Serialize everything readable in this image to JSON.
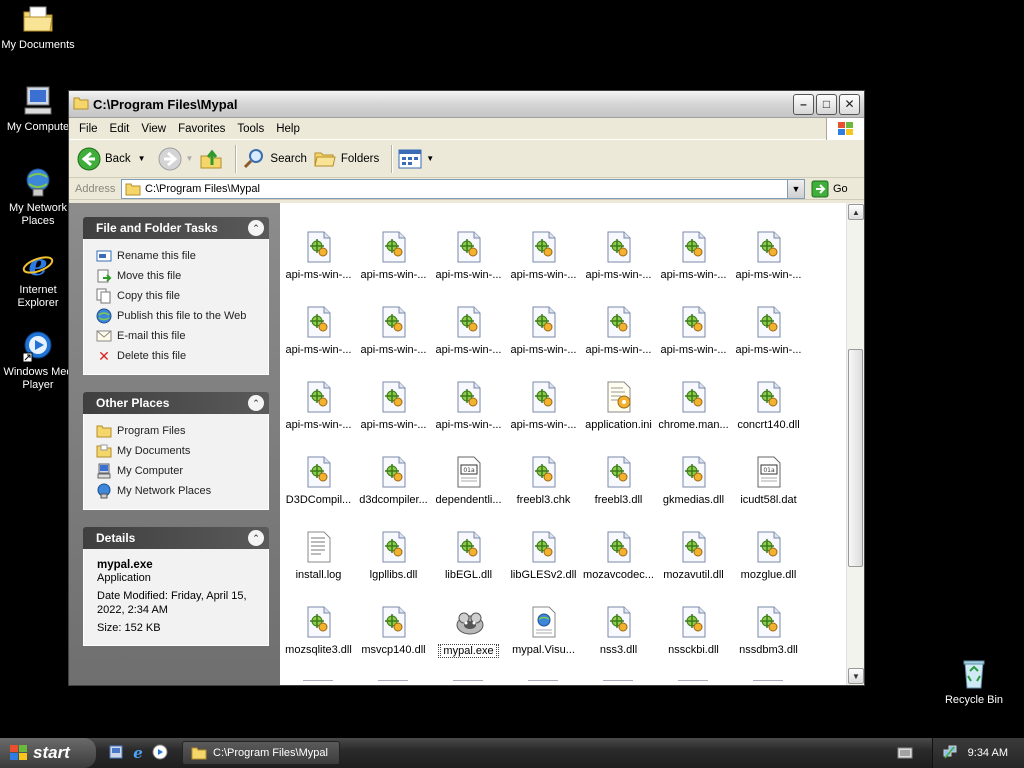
{
  "desktop": {
    "icons": [
      {
        "label": "My Documents"
      },
      {
        "label": "My Compute"
      },
      {
        "label": "My Network Places"
      },
      {
        "label": "Internet Explorer"
      },
      {
        "label": "Windows Med Player"
      },
      {
        "label": "Recycle Bin"
      }
    ]
  },
  "window": {
    "title": "C:\\Program Files\\Mypal",
    "menu": [
      "File",
      "Edit",
      "View",
      "Favorites",
      "Tools",
      "Help"
    ],
    "toolbar": {
      "back": "Back",
      "search": "Search",
      "folders": "Folders"
    },
    "address": {
      "label": "Address",
      "value": "C:\\Program Files\\Mypal",
      "go": "Go"
    }
  },
  "file_tasks": {
    "title": "File and Folder Tasks",
    "items": [
      "Rename this file",
      "Move this file",
      "Copy this file",
      "Publish this file to the Web",
      "E-mail this file",
      "Delete this file"
    ]
  },
  "other_places": {
    "title": "Other Places",
    "items": [
      "Program Files",
      "My Documents",
      "My Computer",
      "My Network Places"
    ]
  },
  "details": {
    "title": "Details",
    "name": "mypal.exe",
    "type": "Application",
    "modified_line1": "Date Modified: Friday, April 15,",
    "modified_line2": "2022, 2:34 AM",
    "size": "Size: 152 KB"
  },
  "files": [
    "api-ms-win-...",
    "api-ms-win-...",
    "api-ms-win-...",
    "api-ms-win-...",
    "api-ms-win-...",
    "api-ms-win-...",
    "api-ms-win-...",
    "api-ms-win-...",
    "api-ms-win-...",
    "api-ms-win-...",
    "api-ms-win-...",
    "api-ms-win-...",
    "api-ms-win-...",
    "api-ms-win-...",
    "api-ms-win-...",
    "api-ms-win-...",
    "api-ms-win-...",
    "api-ms-win-...",
    "application.ini",
    "chrome.man...",
    "concrt140.dll",
    "D3DCompil...",
    "d3dcompiler...",
    "dependentli...",
    "freebl3.chk",
    "freebl3.dll",
    "gkmedias.dll",
    "icudt58l.dat",
    "install.log",
    "lgpllibs.dll",
    "libEGL.dll",
    "libGLESv2.dll",
    "mozavcodec...",
    "mozavutil.dll",
    "mozglue.dll",
    "mozsqlite3.dll",
    "msvcp140.dll",
    "mypal.exe",
    "mypal.Visu...",
    "nss3.dll",
    "nssckbi.dll",
    "nssdbm3.dll"
  ],
  "file_kinds": [
    "dll",
    "dll",
    "dll",
    "dll",
    "dll",
    "dll",
    "dll",
    "dll",
    "dll",
    "dll",
    "dll",
    "dll",
    "dll",
    "dll",
    "dll",
    "dll",
    "dll",
    "dll",
    "ini",
    "dll",
    "dll",
    "dll",
    "dll",
    "dat",
    "dll",
    "dll",
    "dll",
    "dat",
    "txt",
    "dll",
    "dll",
    "dll",
    "dll",
    "dll",
    "dll",
    "dll",
    "dll",
    "exe",
    "manifest",
    "dll",
    "dll",
    "dll"
  ],
  "selected_file": "mypal.exe",
  "taskbar": {
    "start": "start",
    "task_button": "C:\\Program Files\\Mypal",
    "clock": "9:34 AM"
  }
}
